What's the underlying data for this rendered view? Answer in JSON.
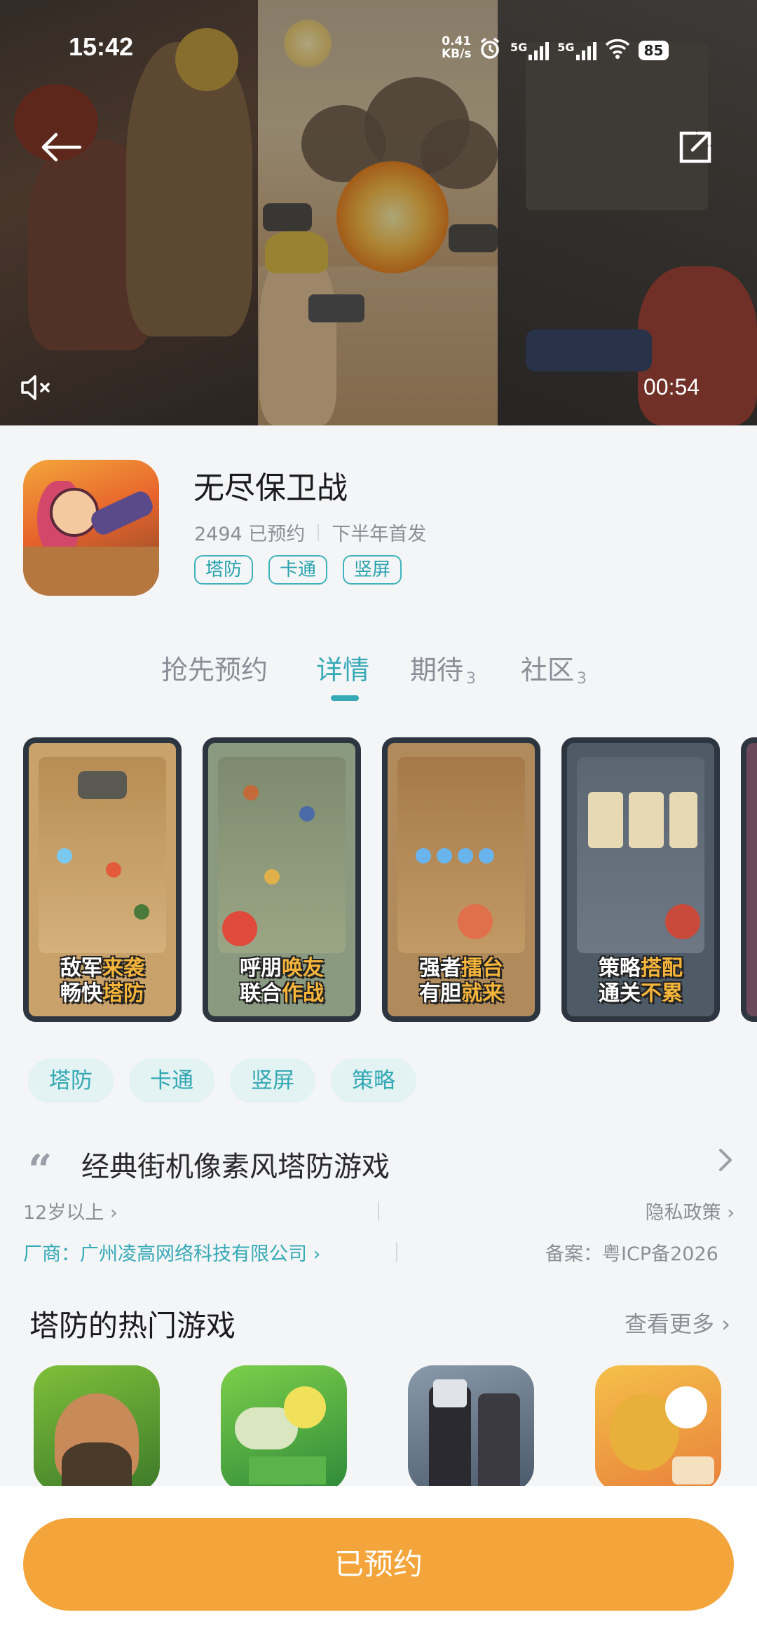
{
  "status_bar": {
    "time": "15:42",
    "net_speed_value": "0.41",
    "net_speed_unit": "KB/s",
    "network_1": "5G",
    "network_2": "5G",
    "battery": "85"
  },
  "video": {
    "duration": "00:54",
    "icons": [
      "back-arrow-icon",
      "share-icon",
      "mute-icon"
    ]
  },
  "game": {
    "title": "无尽保卫战",
    "reservations": "2494 已预约",
    "release": "下半年首发",
    "tags": [
      "塔防",
      "卡通",
      "竖屏"
    ]
  },
  "tabs": [
    {
      "label": "抢先预约",
      "count": ""
    },
    {
      "label": "详情",
      "count": ""
    },
    {
      "label": "期待",
      "count": "3"
    },
    {
      "label": "社区",
      "count": "3"
    }
  ],
  "screenshots": [
    {
      "line1_a": "敌军",
      "line1_b": "来袭",
      "line2_a": "畅快",
      "line2_b": "塔防"
    },
    {
      "line1_a": "呼朋",
      "line1_b": "唤友",
      "line2_a": "联合",
      "line2_b": "作战"
    },
    {
      "line1_a": "强者",
      "line1_b": "擂台",
      "line2_a": "有胆",
      "line2_b": "就来"
    },
    {
      "line1_a": "策略",
      "line1_b": "搭配",
      "line2_a": "通关",
      "line2_b": "不累"
    }
  ],
  "category_tags": [
    "塔防",
    "卡通",
    "竖屏",
    "策略"
  ],
  "quote": {
    "text": "经典街机像素风塔防游戏"
  },
  "info": {
    "age": "12岁以上 ›",
    "privacy": "隐私政策 ›",
    "developer": "厂商：广州凌高网络科技有限公司 ›",
    "icp": "备案：粤ICP备2026"
  },
  "popular": {
    "title": "塔防的热门游戏",
    "see_more": "查看更多 ›"
  },
  "bottom": {
    "button_label": "已预约"
  },
  "colors": {
    "accent": "#36aab6",
    "button": "#f3a43a",
    "background": "#f4f5f7"
  }
}
